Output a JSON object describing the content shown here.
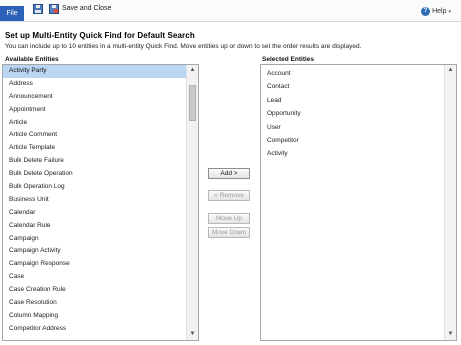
{
  "toolbar": {
    "file_label": "File",
    "save_icon": "save-icon",
    "save_close_label": "Save and Close",
    "help_label": "Help",
    "help_caret": "▾"
  },
  "page": {
    "title": "Set up Multi-Entity Quick Find for Default Search",
    "description": "You can include up to 10 entities in a multi-entity Quick Find. Move entities up or down to set the order results are displayed."
  },
  "available": {
    "label": "Available Entities",
    "selected_item": "Activity Party",
    "items": [
      "Activity Party",
      "Address",
      "Announcement",
      "Appointment",
      "Article",
      "Article Comment",
      "Article Template",
      "Bulk Delete Failure",
      "Bulk Delete Operation",
      "Bulk Operation Log",
      "Business Unit",
      "Calendar",
      "Calendar Rule",
      "Campaign",
      "Campaign Activity",
      "Campaign Response",
      "Case",
      "Case Creation Rule",
      "Case Resolution",
      "Column Mapping",
      "Competitor Address"
    ]
  },
  "selected": {
    "label": "Selected Entities",
    "items": [
      "Account",
      "Contact",
      "Lead",
      "Opportunity",
      "User",
      "Competitor",
      "Activity"
    ]
  },
  "buttons": {
    "add": "Add >",
    "remove": "< Remove",
    "move_up": "Move Up",
    "move_down": "Move Down"
  },
  "scroll": {
    "up_glyph": "▲",
    "down_glyph": "▼"
  }
}
